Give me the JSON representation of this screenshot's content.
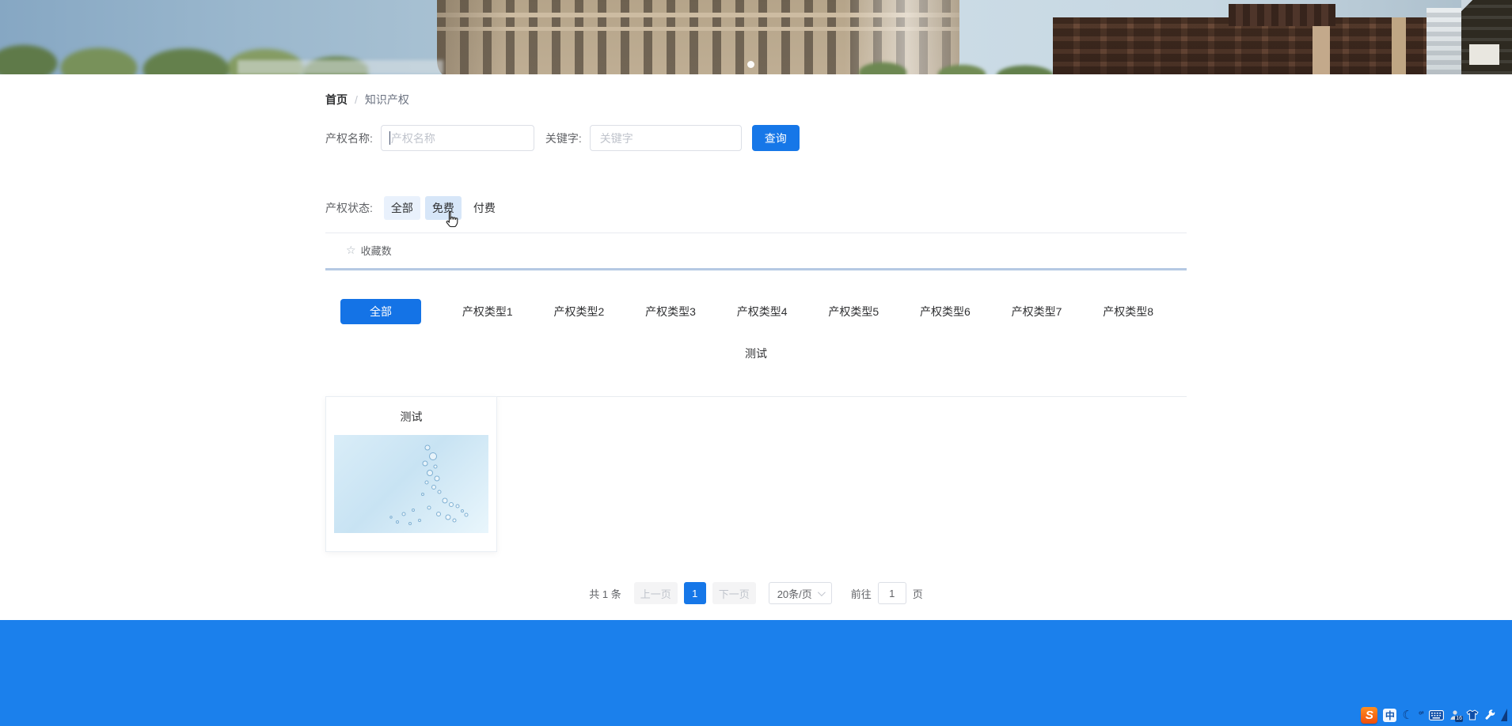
{
  "breadcrumb": {
    "home": "首页",
    "separator": "/",
    "current": "知识产权"
  },
  "search_form": {
    "name_label": "产权名称:",
    "name_placeholder": "产权名称",
    "keyword_label": "关键字:",
    "keyword_placeholder": "关键字",
    "submit_label": "查询"
  },
  "status_filter": {
    "label": "产权状态:",
    "options": [
      {
        "label": "全部",
        "state": "selected"
      },
      {
        "label": "免费",
        "state": "hover"
      },
      {
        "label": "付费",
        "state": "normal"
      }
    ]
  },
  "sort_bar": {
    "star_icon": "☆",
    "favorite_label": "收藏数"
  },
  "category_tabs": {
    "active": "全部",
    "row1": [
      "全部",
      "产权类型1",
      "产权类型2",
      "产权类型3",
      "产权类型4",
      "产权类型5",
      "产权类型6",
      "产权类型7",
      "产权类型8"
    ],
    "row2": [
      "测试"
    ]
  },
  "cards": [
    {
      "title": "测试"
    }
  ],
  "pagination": {
    "total_text": "共 1 条",
    "prev_label": "上一页",
    "active_page": "1",
    "next_label": "下一页",
    "page_size": "20条/页",
    "goto_label": "前往",
    "goto_value": "1",
    "goto_suffix": "页"
  },
  "ime_toolbar": {
    "logo": "S",
    "lang": "中",
    "moon": "☾",
    "punctuation": "°’",
    "badge": "16"
  },
  "colors": {
    "primary": "#1677e8",
    "tab_active": "#1473e6",
    "footer": "#1b80ec",
    "status_selected_bg": "#e9f1fc",
    "status_hover_bg": "#d7e6f8",
    "divider_thick": "#b5c9e3",
    "disabled_bg": "#f4f4f5",
    "disabled_text": "#c0c4cc"
  }
}
